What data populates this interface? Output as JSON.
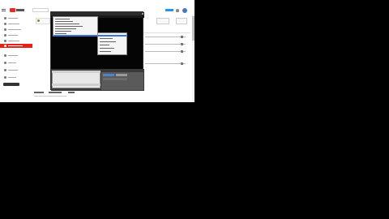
{
  "colors": {
    "brand_red": "#e52d27",
    "guide_active": "#e62117",
    "accent_blue": "#2793e6",
    "selection_blue": "#3875d7",
    "player_bg": "#050505"
  },
  "icons": {
    "menu": "hamburger-icon",
    "logo": "play-logo-icon",
    "bell": "bell-icon",
    "close": "close-icon"
  },
  "masthead": {
    "search_placeholder": ""
  },
  "guide": {
    "items": [
      "",
      "",
      "",
      "",
      "",
      "",
      "",
      ""
    ],
    "active_index": 5
  },
  "player": {
    "menu_items": [
      "",
      "",
      "",
      "",
      "",
      "",
      "",
      ""
    ],
    "submenu_items": [
      "",
      "",
      "",
      "",
      "",
      ""
    ]
  },
  "below": {
    "tabs": [
      "",
      "",
      ""
    ]
  }
}
